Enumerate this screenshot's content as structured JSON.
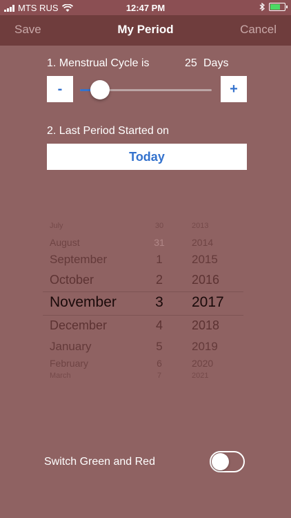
{
  "status_bar": {
    "carrier": "MTS RUS",
    "time": "12:47 PM"
  },
  "nav": {
    "save_label": "Save",
    "title": "My Period",
    "cancel_label": "Cancel"
  },
  "cycle": {
    "label": "1. Menstrual Cycle is",
    "value": "25",
    "unit": "Days",
    "minus_label": "-",
    "plus_label": "+",
    "slider_level": 0.15
  },
  "last_period": {
    "label": "2. Last Period Started on",
    "button_label": "Today"
  },
  "picker": {
    "selected_index": 4,
    "rows": [
      {
        "month": "July",
        "day": "30",
        "year": "2013"
      },
      {
        "month": "August",
        "day": "31",
        "year": "2014"
      },
      {
        "month": "September",
        "day": "1",
        "year": "2015"
      },
      {
        "month": "October",
        "day": "2",
        "year": "2016"
      },
      {
        "month": "November",
        "day": "3",
        "year": "2017"
      },
      {
        "month": "December",
        "day": "4",
        "year": "2018"
      },
      {
        "month": "January",
        "day": "5",
        "year": "2019"
      },
      {
        "month": "February",
        "day": "6",
        "year": "2020"
      },
      {
        "month": "March",
        "day": "7",
        "year": "2021"
      }
    ]
  },
  "switch": {
    "label": "Switch Green and Red",
    "on": false
  },
  "colors": {
    "background": "#8f6262",
    "nav_bar": "#6f3d3d",
    "accent_blue": "#3472cd",
    "battery_green": "#4cd964"
  }
}
